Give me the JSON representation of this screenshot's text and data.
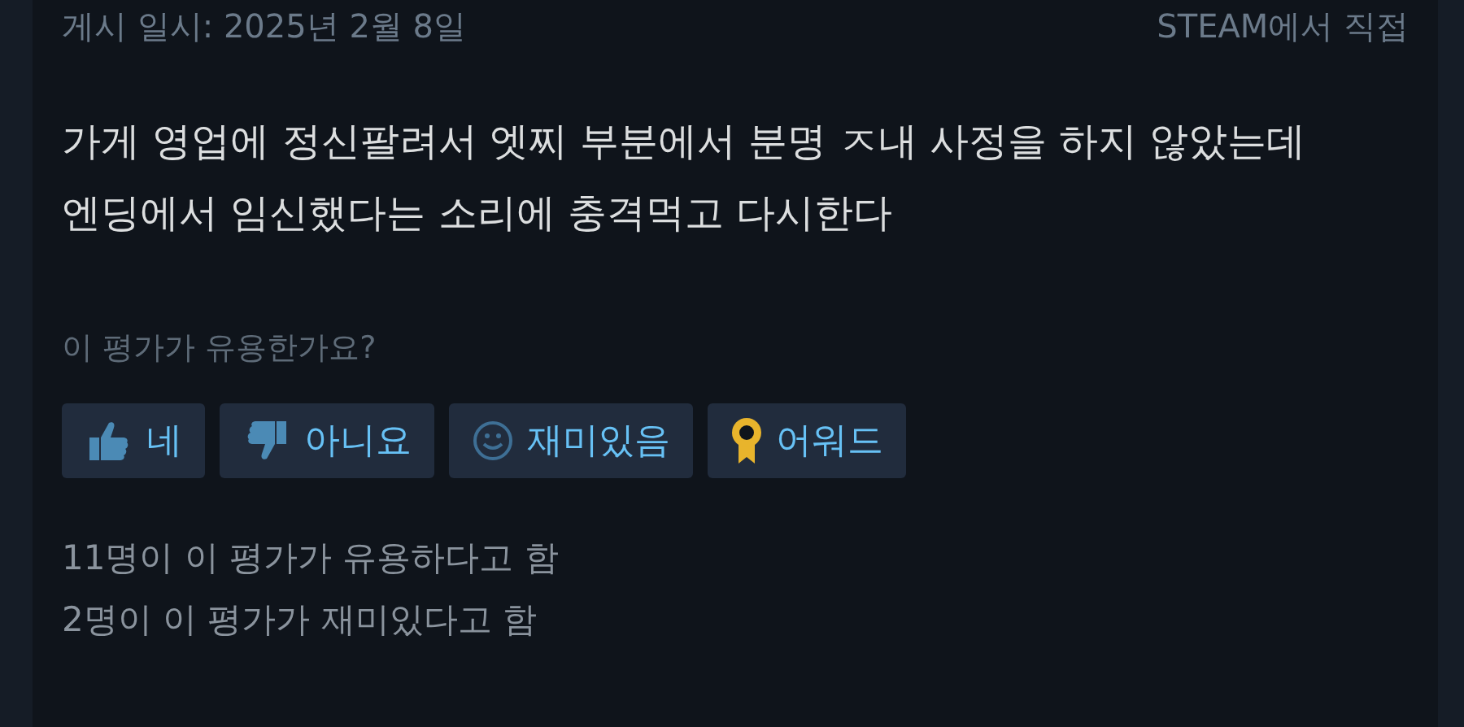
{
  "header": {
    "posted": "게시 일시: 2025년 2월 8일",
    "source": "STEAM에서 직접"
  },
  "review_text": [
    "가게 영업에 정신팔려서 엣찌 부분에서 분명 ㅈ내 사정을 하지 않았는데",
    "엔딩에서 임신했다는 소리에 충격먹고 다시한다"
  ],
  "helpful_question": "이 평가가 유용한가요?",
  "vote_buttons": [
    {
      "kind": "thumbs-up",
      "label": "네"
    },
    {
      "kind": "thumbs-down",
      "label": "아니요"
    },
    {
      "kind": "smile",
      "label": "재미있음"
    },
    {
      "kind": "award",
      "label": "어워드"
    }
  ],
  "stats": [
    "11명이 이 평가가 유용하다고 함",
    "2명이 이 평가가 재미있다고 함"
  ]
}
